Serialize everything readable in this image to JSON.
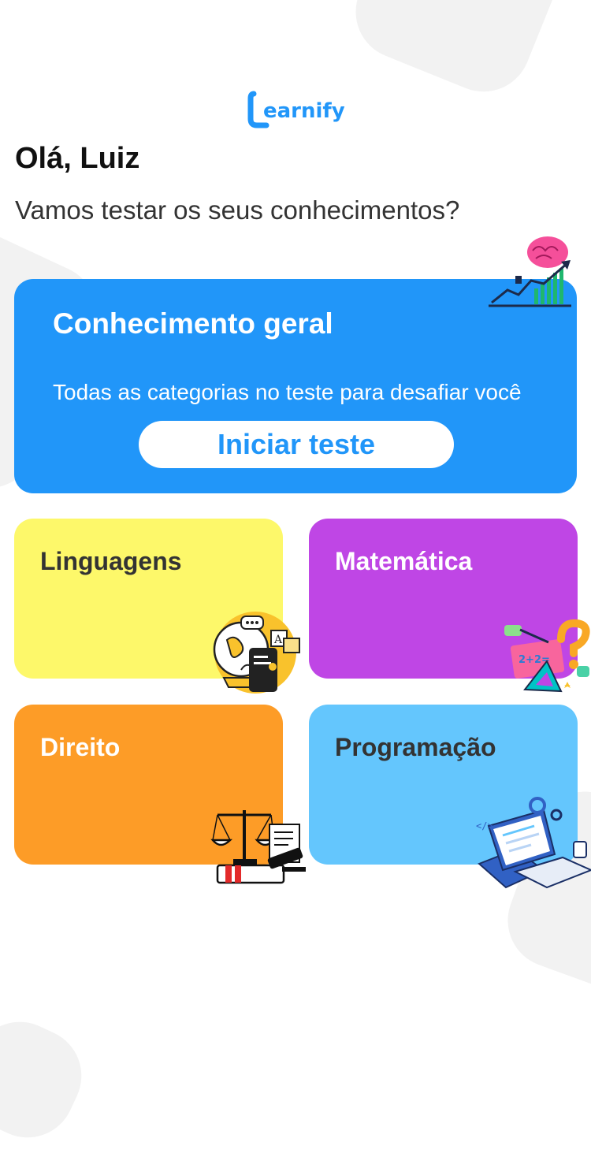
{
  "brand": {
    "logo_text": "Learnify",
    "color": "#2196f9"
  },
  "header": {
    "greeting": "Olá, Luiz",
    "subtitle": "Vamos testar os seus conhecimentos?"
  },
  "hero": {
    "title": "Conhecimento geral",
    "description": "Todas as categorias no teste para desafiar você",
    "button_label": "Iniciar teste",
    "color": "#2196f9",
    "icon": "brain-growth-chart-icon"
  },
  "categories": [
    {
      "label": "Linguagens",
      "color": "#fdf86a",
      "icon": "globe-languages-icon"
    },
    {
      "label": "Matemática",
      "color": "#bf46e5",
      "icon": "math-question-icon"
    },
    {
      "label": "Direito",
      "color": "#fd9c27",
      "icon": "scales-of-justice-icon"
    },
    {
      "label": "Programação",
      "color": "#64c6fd",
      "icon": "laptop-code-icon"
    }
  ]
}
